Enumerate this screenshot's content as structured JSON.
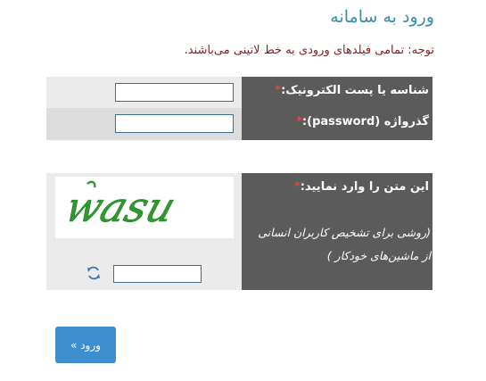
{
  "page": {
    "title": "ورود به سامانه",
    "notice": "توجه: تمامی فیلدهای ورودی به خط لاتینی می‌باشند."
  },
  "form": {
    "username_label": "شناسه یا پست الکترونیک:",
    "password_label": "گذرواژه (password):",
    "required_mark": "*",
    "username_value": "",
    "password_value": ""
  },
  "captcha": {
    "label": "این متن را وارد نمایید:",
    "hint_line1": "(روشی برای تشخیص کاربران انسانی",
    "hint_line2": "از ماشین‌های خودکار )",
    "image_text": "wasu",
    "input_value": "",
    "refresh_icon": "refresh-icon"
  },
  "actions": {
    "submit_label": "ورود »"
  },
  "colors": {
    "title": "#3a8fa8",
    "notice": "#8b1a1a",
    "panel_dark": "#5b5b5b",
    "panel_light": "#ebebeb",
    "required": "#ff3b3b",
    "captcha_text": "#2e9a2e",
    "button": "#3e8ed0"
  }
}
